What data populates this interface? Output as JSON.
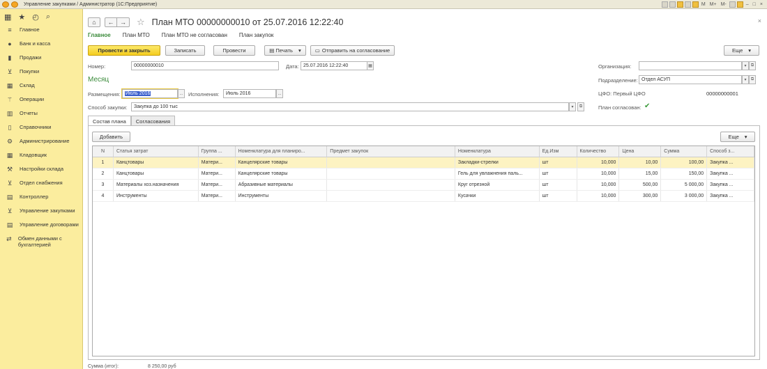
{
  "window": {
    "title": "Управление закупками / Администратор  (1С:Предприятие)",
    "toolbar_labels": [
      "M",
      "M+",
      "M-"
    ]
  },
  "sidebar": {
    "items": [
      {
        "label": "Главное",
        "icon": "menu-icon"
      },
      {
        "label": "Банк и касса",
        "icon": "coin-icon"
      },
      {
        "label": "Продажи",
        "icon": "bag-icon"
      },
      {
        "label": "Покупки",
        "icon": "cart-icon"
      },
      {
        "label": "Склад",
        "icon": "warehouse-icon"
      },
      {
        "label": "Операции",
        "icon": "operations-icon"
      },
      {
        "label": "Отчеты",
        "icon": "chart-icon"
      },
      {
        "label": "Справочники",
        "icon": "book-icon"
      },
      {
        "label": "Администрирование",
        "icon": "gear-icon"
      },
      {
        "label": "Кладовщик",
        "icon": "warehouse-icon"
      },
      {
        "label": "Настройки склада",
        "icon": "wrench-icon"
      },
      {
        "label": "Отдел снабжения",
        "icon": "cart-icon"
      },
      {
        "label": "Контроллер",
        "icon": "document-icon"
      },
      {
        "label": "Управление закупками",
        "icon": "cart-icon"
      },
      {
        "label": "Управление договорами",
        "icon": "document-icon"
      },
      {
        "label": "Обмен данными с бухгалтерией",
        "icon": "exchange-icon"
      }
    ]
  },
  "doc": {
    "title": "План МТО 00000000010 от 25.07.2016 12:22:40"
  },
  "tabs": [
    "Главное",
    "План МТО",
    "План МТО не согласован",
    "План закупок"
  ],
  "toolbar": {
    "post_close": "Провести и закрыть",
    "save": "Записать",
    "post": "Провести",
    "print": "Печать",
    "send_approval": "Отправить на согласование",
    "more": "Еще"
  },
  "form": {
    "number_label": "Номер:",
    "number_value": "00000000010",
    "date_label": "Дата:",
    "date_value": "25.07.2016 12:22:40",
    "org_label": "Организация:",
    "org_value": "",
    "dept_label": "Подразделение:",
    "dept_value": "Отдел АСУП",
    "cfo_label": "ЦФО: Первый ЦФО",
    "cfo_code": "00000000001",
    "section_title": "Месяц",
    "placement_label": "Размещения:",
    "placement_value": "Июль 2016",
    "execution_label": "Исполнения:",
    "execution_value": "Июль 2016",
    "method_label": "Способ закупки:",
    "method_value": "Закупка до 100 тыс",
    "approved_label": "План согласован:"
  },
  "subtabs": [
    "Состав плана",
    "Согласования"
  ],
  "grid": {
    "add_label": "Добавить",
    "more_label": "Еще",
    "columns": [
      "N",
      "Статья затрат",
      "Группа ...",
      "Номенклатура для планиро...",
      "Предмет закупок",
      "Номенклатура",
      "Ед.Изм",
      "Количество",
      "Цена",
      "Сумма",
      "Способ з..."
    ],
    "rows": [
      [
        "1",
        "Канцтовары",
        "Матери...",
        "Канцелярские товары",
        "",
        "Закладки-стрелки",
        "шт",
        "10,000",
        "10,00",
        "100,00",
        "Закупка ..."
      ],
      [
        "2",
        "Канцтовары",
        "Матери...",
        "Канцелярские товары",
        "",
        "Гель для увлажнения паль...",
        "шт",
        "10,000",
        "15,00",
        "150,00",
        "Закупка ..."
      ],
      [
        "3",
        "Материалы хоз.назначения",
        "Матери...",
        "Абразивные материалы",
        "",
        "Круг отрезной",
        "шт",
        "10,000",
        "500,00",
        "5 000,00",
        "Закупка ..."
      ],
      [
        "4",
        "Инструменты",
        "Матери...",
        "Инструменты",
        "",
        "Кусачки",
        "шт",
        "10,000",
        "300,00",
        "3 000,00",
        "Закупка ..."
      ]
    ]
  },
  "footer": {
    "total_label": "Сумма (итог):",
    "total_value": "8 250,00 руб"
  }
}
